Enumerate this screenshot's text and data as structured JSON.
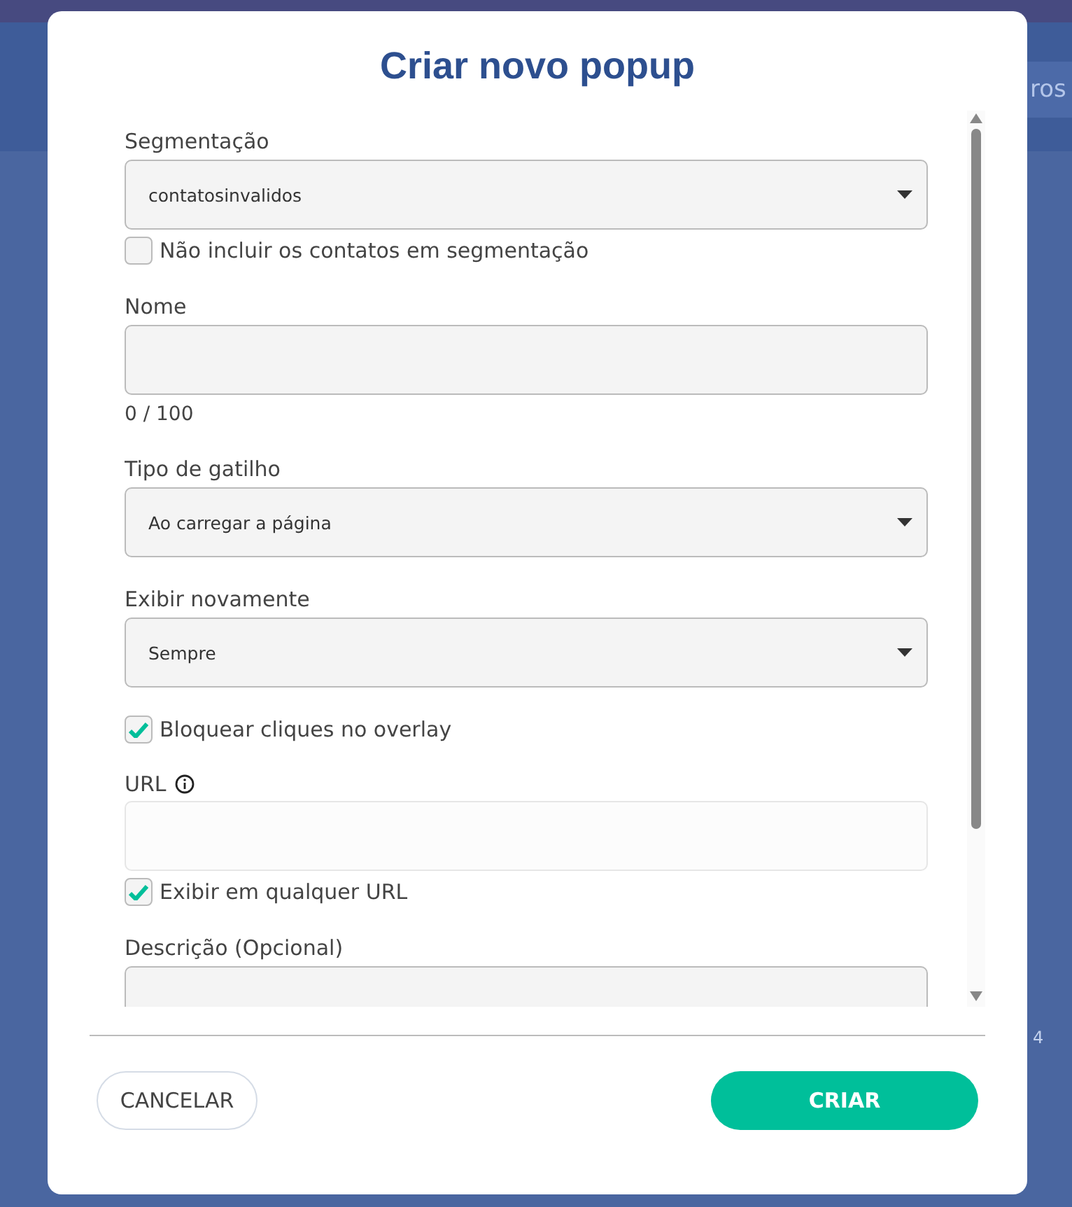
{
  "background": {
    "button": "ros",
    "page_number": "4"
  },
  "dialog": {
    "title": "Criar novo popup",
    "fields": [
      {
        "kind": "select",
        "label": "Segmentação",
        "value": "contatosinvalidos",
        "option": {
          "label": "Não incluir os contatos em segmentação",
          "checked": false
        }
      },
      {
        "kind": "text",
        "label": "Nome",
        "counter": "0 / 100"
      },
      {
        "kind": "select",
        "label": "Tipo de gatilho",
        "value": "Ao carregar a página"
      },
      {
        "kind": "select",
        "label": "Exibir novamente",
        "value": "Sempre"
      },
      {
        "kind": "checkbox",
        "label": "Bloquear cliques no overlay",
        "checked": true
      },
      {
        "kind": "text",
        "label": "URL",
        "info": true,
        "disabled": true,
        "option": {
          "label": "Exibir em qualquer URL",
          "checked": true
        }
      },
      {
        "kind": "textarea",
        "label": "Descrição (Opcional)"
      }
    ],
    "buttons": [
      {
        "label": "CANCELAR",
        "kind": "secondary"
      },
      {
        "label": "CRIAR",
        "kind": "primary"
      }
    ]
  }
}
